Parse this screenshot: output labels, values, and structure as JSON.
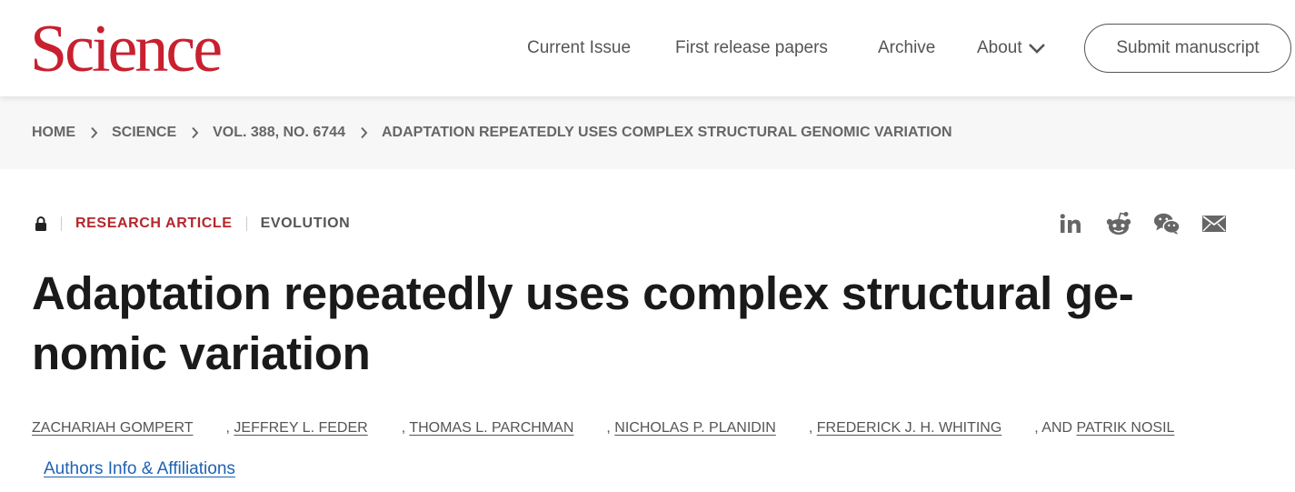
{
  "header": {
    "logo": "Science",
    "nav": [
      "Current Issue",
      "First release papers",
      "Archive",
      "About"
    ],
    "submit_label": "Submit manuscript"
  },
  "breadcrumb": [
    "HOME",
    "SCIENCE",
    "VOL. 388, NO. 6744",
    "ADAPTATION REPEATEDLY USES COMPLEX STRUCTURAL GENOMIC VARIATION"
  ],
  "article": {
    "type": "RESEARCH ARTICLE",
    "category": "EVOLUTION",
    "title_line1": "Adaptation repeatedly uses complex structural ge-",
    "title_line2": "nomic variation",
    "authors": [
      "ZACHARIAH GOMPERT",
      "JEFFREY L. FEDER",
      "THOMAS L. PARCHMAN",
      "NICHOLAS P. PLANIDIN",
      "FREDERICK J. H. WHITING",
      "PATRIK NOSIL"
    ],
    "separator": ",",
    "and_label": ", AND",
    "affiliations_link": "Authors Info & Affiliations"
  },
  "share_icons": [
    "linkedin-icon",
    "reddit-icon",
    "wechat-icon",
    "email-icon"
  ],
  "colors": {
    "brand_red": "#c8202f",
    "article_type": "#b5252c",
    "link_blue": "#1f62b4"
  }
}
